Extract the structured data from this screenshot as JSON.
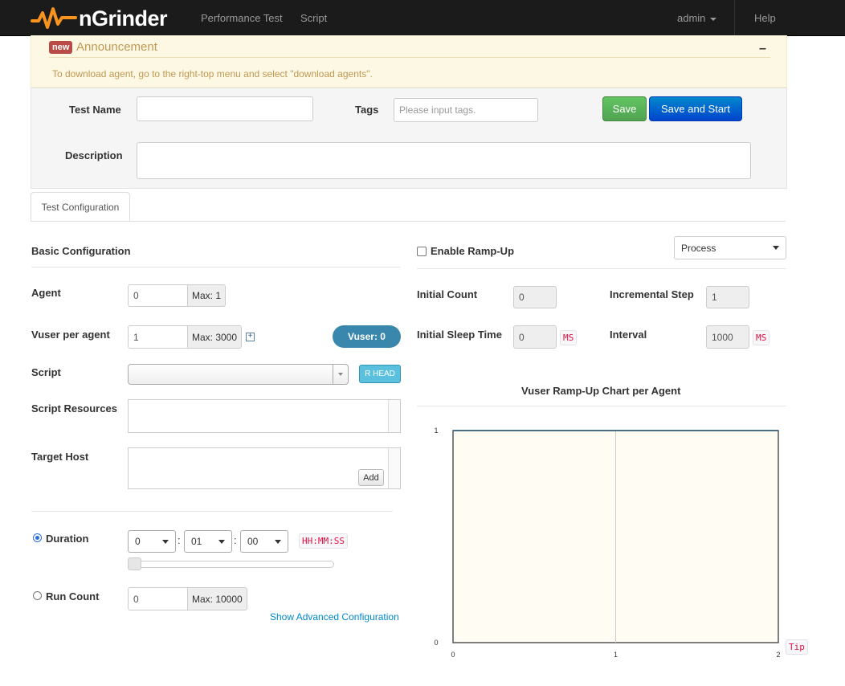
{
  "nav": {
    "brand": "nGrinder",
    "menu": [
      "Performance Test",
      "Script"
    ],
    "user": "admin",
    "help": "Help"
  },
  "announcement": {
    "badge": "new",
    "title": "Announcement",
    "collapse": "–",
    "text": "To download agent, go to the right-top menu and select \"download agents\"."
  },
  "header": {
    "test_name_label": "Test Name",
    "test_name_value": "",
    "tags_label": "Tags",
    "tags_placeholder": "Please input tags.",
    "save": "Save",
    "save_and_start": "Save and Start",
    "description_label": "Description",
    "description_value": ""
  },
  "tabs": [
    "Test Configuration"
  ],
  "basic": {
    "title": "Basic Configuration",
    "agent_label": "Agent",
    "agent_value": "0",
    "agent_max": "Max: 1",
    "vuser_label": "Vuser per agent",
    "vuser_value": "1",
    "vuser_max": "Max: 3000",
    "vuser_expand": "+",
    "vuser_total": "Vuser: 0",
    "script_label": "Script",
    "script_value": "",
    "r_head": "R HEAD",
    "resources_label": "Script Resources",
    "target_host_label": "Target Host",
    "add": "Add",
    "duration_label": "Duration",
    "duration_hours": "0",
    "duration_minutes": "01",
    "duration_seconds": "00",
    "duration_format": "HH:MM:SS",
    "duration_slider": 0,
    "run_count_label": "Run Count",
    "run_count_value": "0",
    "run_count_max": "Max: 10000",
    "advanced_link": "Show Advanced Configuration"
  },
  "rampup": {
    "enable_label": "Enable Ramp-Up",
    "enabled": false,
    "type": "Process",
    "initial_count_label": "Initial Count",
    "initial_count": "0",
    "incremental_step_label": "Incremental Step",
    "incremental_step": "1",
    "initial_sleep_label": "Initial Sleep Time",
    "initial_sleep": "0",
    "ms": "MS",
    "interval_label": "Interval",
    "interval": "1000",
    "tip": "Tip"
  },
  "chart_data": {
    "type": "line",
    "title": "Vuser Ramp-Up Chart per Agent",
    "x_ticks": [
      "0",
      "1",
      "2"
    ],
    "y_ticks": [
      "0",
      "1"
    ],
    "xlim": [
      0,
      2
    ],
    "ylim": [
      0,
      1
    ],
    "series": [
      {
        "x": [
          0,
          2
        ],
        "values": [
          1,
          1
        ]
      }
    ],
    "grid": true,
    "colors": {
      "plot_bg": "#fefcf3",
      "line": "#4a6f8a"
    }
  }
}
